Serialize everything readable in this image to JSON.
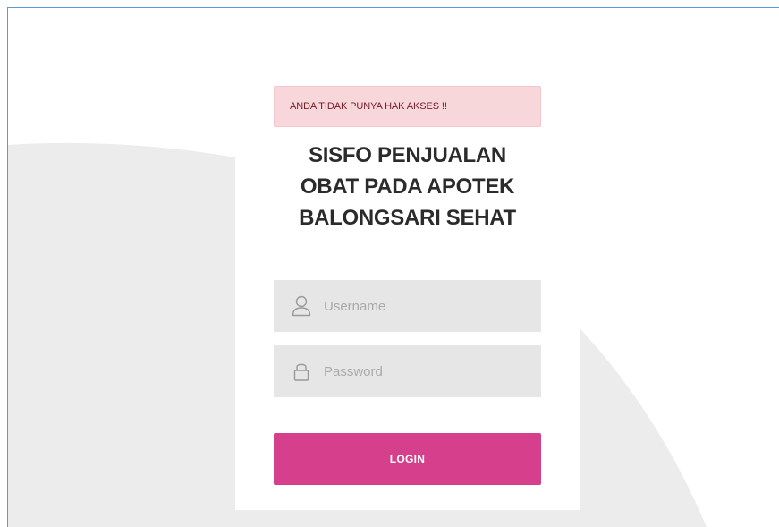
{
  "alert": {
    "message": "ANDA TIDAK PUNYA HAK AKSES !!"
  },
  "title": {
    "line1": "SISFO PENJUALAN",
    "line2": "OBAT PADA APOTEK",
    "line3": "BALONGSARI SEHAT"
  },
  "form": {
    "username": {
      "value": "",
      "placeholder": "Username",
      "icon": "user-icon"
    },
    "password": {
      "value": "",
      "placeholder": "Password",
      "icon": "lock-icon"
    },
    "login_label": "LOGIN"
  },
  "colors": {
    "accent": "#d63f8c",
    "alert_bg": "#f8d7da",
    "alert_text": "#721c24",
    "field_bg": "#e6e6e6",
    "background_shape": "#ececec"
  }
}
